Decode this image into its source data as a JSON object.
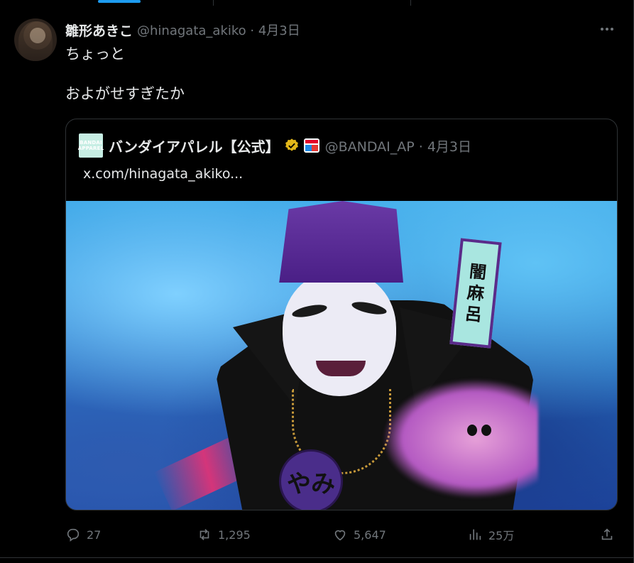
{
  "post": {
    "author_name": "雛形あきこ",
    "meta": "@hinagata_akiko · 4月3日",
    "text_line1": "ちょっと",
    "text_line2": "およがせすぎたか"
  },
  "quote": {
    "logo_text_1": "BANDAI",
    "logo_text_2": "APPAREL",
    "author_name": "バンダイアパレル【公式】",
    "meta": "@BANDAI_AP · 4月3日",
    "text": "x.com/hinagata_akiko...",
    "image": {
      "sign_chars": [
        "闇",
        "麻",
        "呂"
      ],
      "medal_text": "やみ"
    }
  },
  "actions": {
    "replies": "27",
    "reposts": "1,295",
    "likes": "5,647",
    "views": "25万"
  },
  "icons": {
    "more": "more-icon",
    "reply": "reply-icon",
    "repost": "repost-icon",
    "like": "heart-icon",
    "views": "views-icon",
    "share": "share-icon",
    "verified": "verified-badge-icon"
  },
  "colors": {
    "background": "#000000",
    "text": "#e7e9ea",
    "muted": "#71767b",
    "accent": "#1d9bf0",
    "verified_gold": "#e2b719",
    "border": "#2f3336"
  }
}
